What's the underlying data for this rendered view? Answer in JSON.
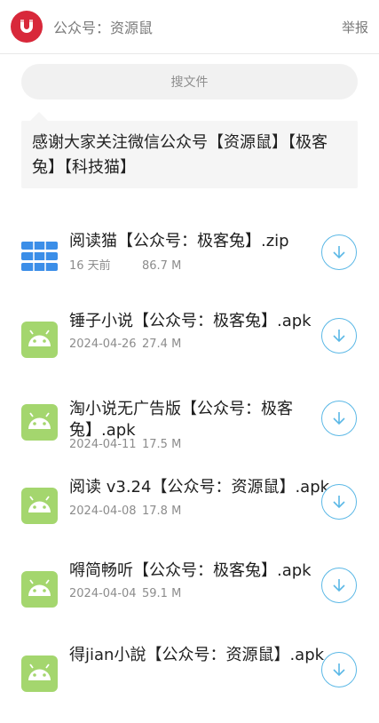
{
  "header": {
    "account_label": "公众号：资源鼠",
    "report_label": "举报",
    "brand_color": "#d8283a"
  },
  "search": {
    "placeholder": "搜文件"
  },
  "notice": {
    "text": "感谢大家关注微信公众号【资源鼠】【极客兔】【科技猫】"
  },
  "files": [
    {
      "name": "阅读猫【公众号：极客兔】.zip",
      "date": "16 天前",
      "size": "86.7 M",
      "icon": "archive-icon"
    },
    {
      "name": "锤子小说【公众号：极客兔】.apk",
      "date": "2024-04-26",
      "size": "27.4 M",
      "icon": "android-icon"
    },
    {
      "name": "淘小说无广告版【公众号：极客兔】.apk",
      "date": "2024-04-11",
      "size": "17.5 M",
      "icon": "android-icon"
    },
    {
      "name": "阅读 v3.24【公众号：资源鼠】.apk",
      "date": "2024-04-08",
      "size": "17.8 M",
      "icon": "android-icon"
    },
    {
      "name": "嘚简畅听【公众号：极客兔】.apk",
      "date": "2024-04-04",
      "size": "59.1 M",
      "icon": "android-icon"
    },
    {
      "name": "得jian小說【公众号：资源鼠】.apk",
      "date": "",
      "size": "",
      "icon": "android-icon"
    }
  ],
  "colors": {
    "android_green": "#a4d66e",
    "archive_blue": "#3b8ee8",
    "download_blue": "#5bb8e6"
  }
}
